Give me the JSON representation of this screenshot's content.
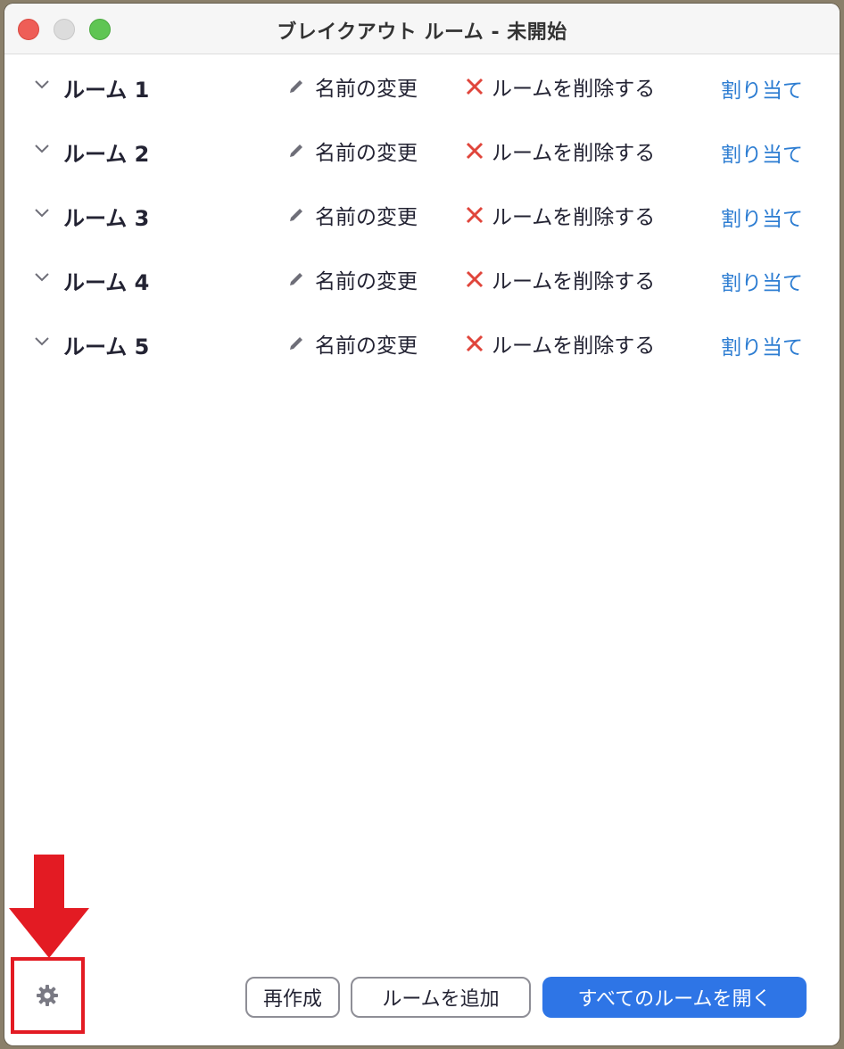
{
  "window": {
    "title": "ブレイクアウト ルーム - 未開始"
  },
  "rooms": [
    {
      "name": "ルーム 1",
      "rename_label": "名前の変更",
      "delete_label": "ルームを削除する",
      "assign_label": "割り当て"
    },
    {
      "name": "ルーム 2",
      "rename_label": "名前の変更",
      "delete_label": "ルームを削除する",
      "assign_label": "割り当て"
    },
    {
      "name": "ルーム 3",
      "rename_label": "名前の変更",
      "delete_label": "ルームを削除する",
      "assign_label": "割り当て"
    },
    {
      "name": "ルーム 4",
      "rename_label": "名前の変更",
      "delete_label": "ルームを削除する",
      "assign_label": "割り当て"
    },
    {
      "name": "ルーム 5",
      "rename_label": "名前の変更",
      "delete_label": "ルームを削除する",
      "assign_label": "割り当て"
    }
  ],
  "footer": {
    "settings_icon": "gear-icon",
    "recreate_label": "再作成",
    "add_room_label": "ルームを追加",
    "open_all_label": "すべてのルームを開く"
  },
  "colors": {
    "accent": "#2e75e6",
    "link": "#2d7dd2",
    "delete_icon": "#e0453b",
    "annotation": "#e31b23"
  }
}
